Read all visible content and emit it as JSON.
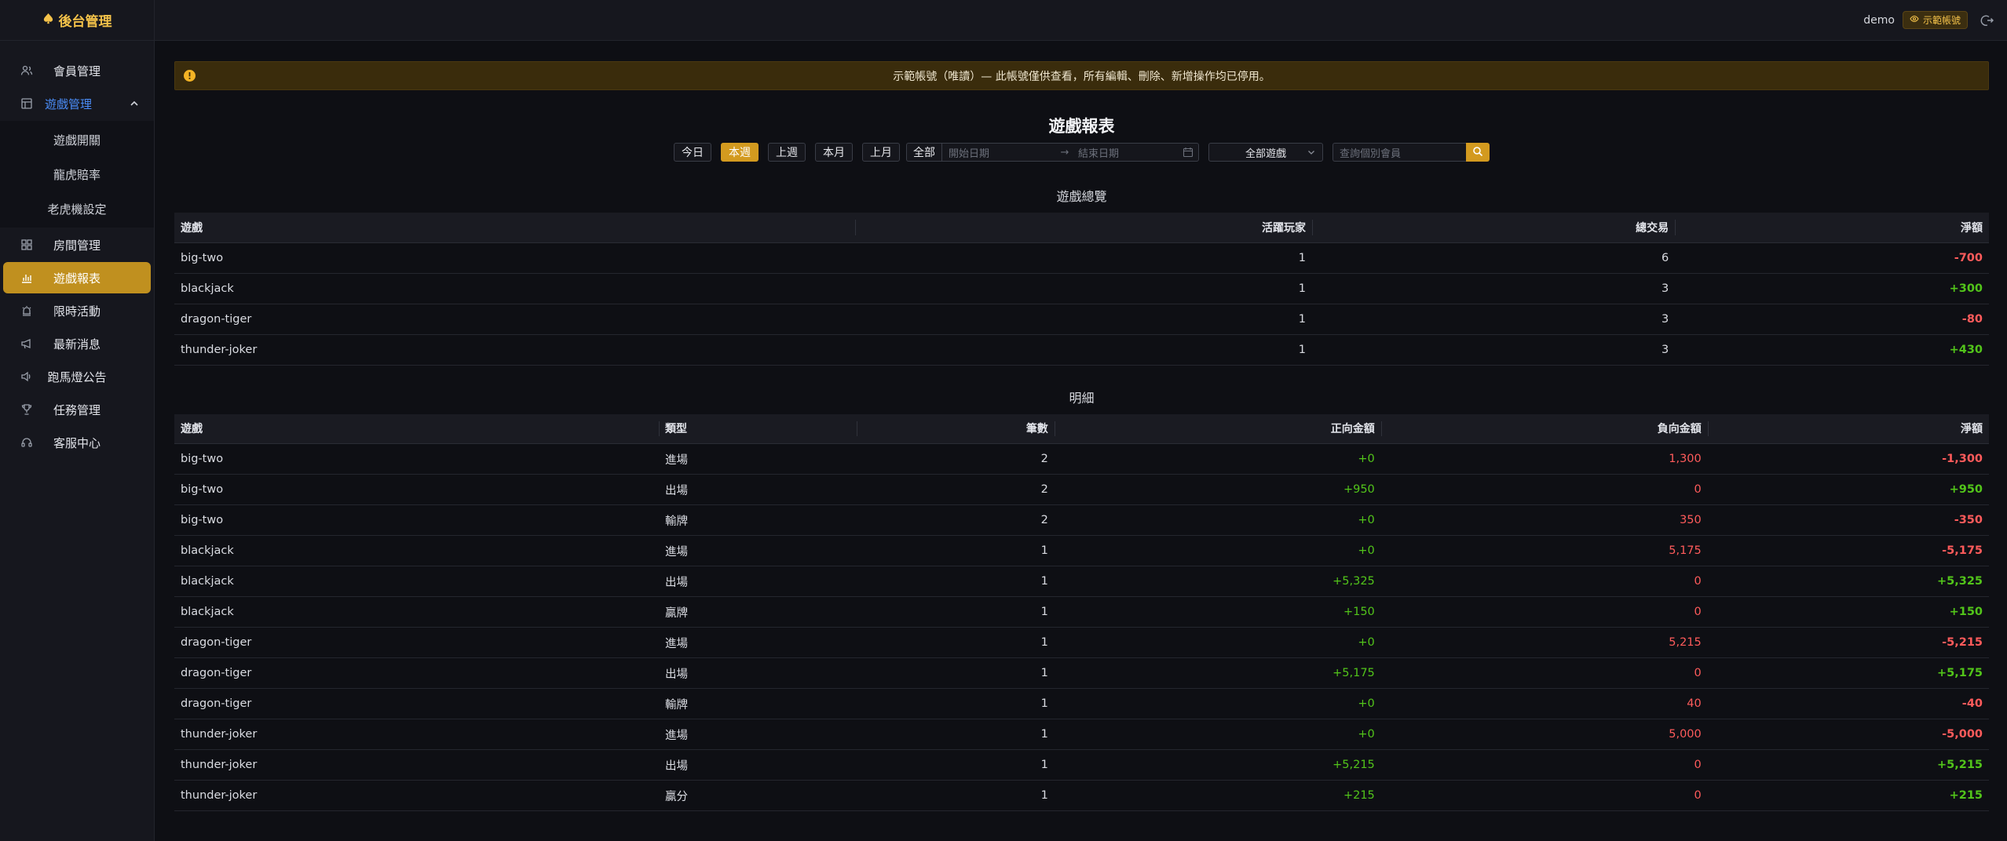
{
  "brand": {
    "title": "後台管理"
  },
  "sidebar": {
    "items": [
      {
        "label": "會員管理",
        "icon": "members-icon"
      },
      {
        "label": "遊戲管理",
        "icon": "games-icon"
      },
      {
        "label": "房間管理",
        "icon": "rooms-icon"
      },
      {
        "label": "遊戲報表",
        "icon": "report-chart-icon"
      },
      {
        "label": "限時活動",
        "icon": "alarm-icon"
      },
      {
        "label": "最新消息",
        "icon": "megaphone-icon"
      },
      {
        "label": "跑馬燈公告",
        "icon": "speaker-icon"
      },
      {
        "label": "任務管理",
        "icon": "trophy-icon"
      },
      {
        "label": "客服中心",
        "icon": "headset-icon"
      }
    ],
    "sub_items": [
      "遊戲開關",
      "龍虎賠率",
      "老虎機設定"
    ]
  },
  "topbar": {
    "user": "demo",
    "badge": "示範帳號"
  },
  "alert": {
    "text": "示範帳號（唯讀）— 此帳號僅供查看，所有編輯、刪除、新增操作均已停用。"
  },
  "page": {
    "title": "遊戲報表"
  },
  "filters": {
    "today": "今日",
    "this_week": "本週",
    "last_week": "上週",
    "this_month": "本月",
    "last_month": "上月",
    "all": "全部",
    "start_placeholder": "開始日期",
    "end_placeholder": "結束日期",
    "game_select": "全部遊戲",
    "member_placeholder": "查詢個別會員"
  },
  "summary": {
    "title": "遊戲總覽",
    "headers": {
      "game": "遊戲",
      "players": "活躍玩家",
      "trades": "總交易",
      "net": "淨額"
    },
    "rows": [
      {
        "game": "big-two",
        "players": "1",
        "trades": "6",
        "net": "-700",
        "sign": "neg"
      },
      {
        "game": "blackjack",
        "players": "1",
        "trades": "3",
        "net": "+300",
        "sign": "pos"
      },
      {
        "game": "dragon-tiger",
        "players": "1",
        "trades": "3",
        "net": "-80",
        "sign": "neg"
      },
      {
        "game": "thunder-joker",
        "players": "1",
        "trades": "3",
        "net": "+430",
        "sign": "pos"
      }
    ]
  },
  "detail": {
    "title": "明細",
    "headers": {
      "game": "遊戲",
      "type": "類型",
      "count": "筆數",
      "positive": "正向金額",
      "negative": "負向金額",
      "net": "淨額"
    },
    "rows": [
      {
        "game": "big-two",
        "type": "進場",
        "count": "2",
        "positive": "+0",
        "negative": "1,300",
        "net": "-1,300",
        "sign": "neg"
      },
      {
        "game": "big-two",
        "type": "出場",
        "count": "2",
        "positive": "+950",
        "negative": "0",
        "net": "+950",
        "sign": "pos"
      },
      {
        "game": "big-two",
        "type": "輸牌",
        "count": "2",
        "positive": "+0",
        "negative": "350",
        "net": "-350",
        "sign": "neg"
      },
      {
        "game": "blackjack",
        "type": "進場",
        "count": "1",
        "positive": "+0",
        "negative": "5,175",
        "net": "-5,175",
        "sign": "neg"
      },
      {
        "game": "blackjack",
        "type": "出場",
        "count": "1",
        "positive": "+5,325",
        "negative": "0",
        "net": "+5,325",
        "sign": "pos"
      },
      {
        "game": "blackjack",
        "type": "贏牌",
        "count": "1",
        "positive": "+150",
        "negative": "0",
        "net": "+150",
        "sign": "pos"
      },
      {
        "game": "dragon-tiger",
        "type": "進場",
        "count": "1",
        "positive": "+0",
        "negative": "5,215",
        "net": "-5,215",
        "sign": "neg"
      },
      {
        "game": "dragon-tiger",
        "type": "出場",
        "count": "1",
        "positive": "+5,175",
        "negative": "0",
        "net": "+5,175",
        "sign": "pos"
      },
      {
        "game": "dragon-tiger",
        "type": "輸牌",
        "count": "1",
        "positive": "+0",
        "negative": "40",
        "net": "-40",
        "sign": "neg"
      },
      {
        "game": "thunder-joker",
        "type": "進場",
        "count": "1",
        "positive": "+0",
        "negative": "5,000",
        "net": "-5,000",
        "sign": "neg"
      },
      {
        "game": "thunder-joker",
        "type": "出場",
        "count": "1",
        "positive": "+5,215",
        "negative": "0",
        "net": "+5,215",
        "sign": "pos"
      },
      {
        "game": "thunder-joker",
        "type": "贏分",
        "count": "1",
        "positive": "+215",
        "negative": "0",
        "net": "+215",
        "sign": "pos"
      }
    ]
  }
}
